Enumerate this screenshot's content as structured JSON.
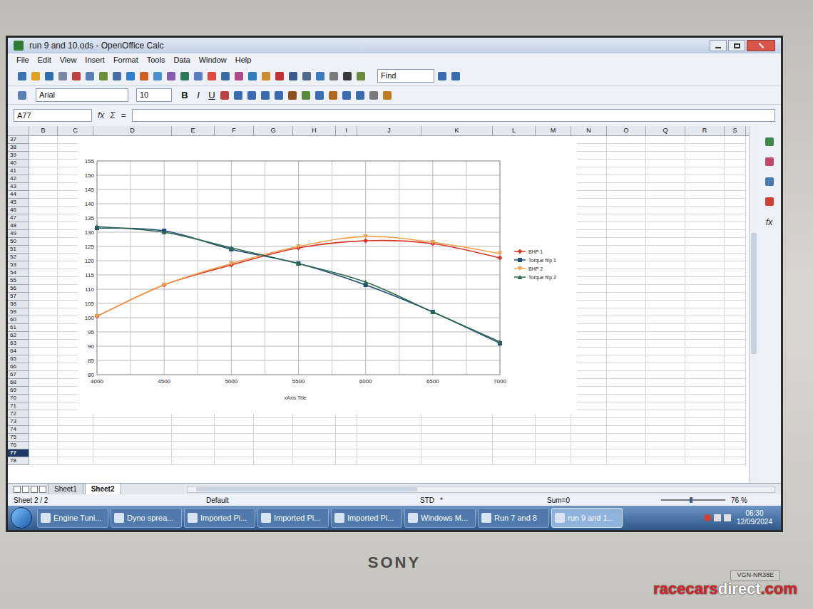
{
  "window": {
    "title": "run 9 and 10.ods - OpenOffice Calc"
  },
  "menu": [
    "File",
    "Edit",
    "View",
    "Insert",
    "Format",
    "Tools",
    "Data",
    "Window",
    "Help"
  ],
  "find": {
    "value": "Find"
  },
  "format_bar": {
    "font": "Arial",
    "size": "10",
    "buttons": [
      "B",
      "I",
      "U"
    ]
  },
  "formula_bar": {
    "cell": "A77",
    "symbols": [
      "fx",
      "Σ",
      "="
    ]
  },
  "columns": [
    "B",
    "C",
    "D",
    "E",
    "F",
    "G",
    "H",
    "I",
    "J",
    "K",
    "L",
    "M",
    "N",
    "O",
    "Q",
    "R",
    "S"
  ],
  "rows": [
    {
      "label": "37",
      "selected": false
    },
    {
      "label": "38",
      "selected": false
    },
    {
      "label": "39",
      "selected": false
    },
    {
      "label": "40",
      "selected": false
    },
    {
      "label": "41",
      "selected": false
    },
    {
      "label": "42",
      "selected": false
    },
    {
      "label": "43",
      "selected": false
    },
    {
      "label": "44",
      "selected": false
    },
    {
      "label": "45",
      "selected": false
    },
    {
      "label": "46",
      "selected": false
    },
    {
      "label": "47",
      "selected": false
    },
    {
      "label": "48",
      "selected": false
    },
    {
      "label": "49",
      "selected": false
    },
    {
      "label": "50",
      "selected": false
    },
    {
      "label": "51",
      "selected": false
    },
    {
      "label": "52",
      "selected": false
    },
    {
      "label": "53",
      "selected": false
    },
    {
      "label": "54",
      "selected": false
    },
    {
      "label": "55",
      "selected": false
    },
    {
      "label": "56",
      "selected": false
    },
    {
      "label": "57",
      "selected": false
    },
    {
      "label": "58",
      "selected": false
    },
    {
      "label": "59",
      "selected": false
    },
    {
      "label": "60",
      "selected": false
    },
    {
      "label": "61",
      "selected": false
    },
    {
      "label": "62",
      "selected": false
    },
    {
      "label": "63",
      "selected": false
    },
    {
      "label": "64",
      "selected": false
    },
    {
      "label": "65",
      "selected": false
    },
    {
      "label": "66",
      "selected": false
    },
    {
      "label": "67",
      "selected": false
    },
    {
      "label": "68",
      "selected": false
    },
    {
      "label": "69",
      "selected": false
    },
    {
      "label": "70",
      "selected": false
    },
    {
      "label": "71",
      "selected": false
    },
    {
      "label": "72",
      "selected": false
    },
    {
      "label": "73",
      "selected": false
    },
    {
      "label": "74",
      "selected": false
    },
    {
      "label": "75",
      "selected": false
    },
    {
      "label": "76",
      "selected": false
    },
    {
      "label": "77",
      "selected": true
    },
    {
      "label": "78",
      "selected": false
    }
  ],
  "chart": {
    "y_ticks": [
      "80",
      "85",
      "90",
      "95",
      "100",
      "105",
      "110",
      "115",
      "120",
      "125",
      "130",
      "135",
      "140",
      "145",
      "150",
      "155"
    ],
    "x_ticks": [
      "4000",
      "4500",
      "5000",
      "5500",
      "6000",
      "6500",
      "7000"
    ],
    "x_title": "xAxis Title",
    "series": [
      {
        "name": "BHP 1",
        "color": "#d9372a",
        "marker": "diamond",
        "values": [
          100.5,
          111.5,
          118.5,
          124.5,
          127,
          126,
          121
        ]
      },
      {
        "name": "Torque ft/p 1",
        "color": "#1f4a7a",
        "marker": "square",
        "values": [
          131.5,
          130.5,
          124,
          119,
          111.5,
          102,
          91
        ]
      },
      {
        "name": "BHP 2",
        "color": "#f0a24e",
        "marker": "triangle-down",
        "values": [
          100.5,
          111.5,
          119,
          125,
          128.5,
          126.5,
          122.5
        ]
      },
      {
        "name": "Torque ft/p 2",
        "color": "#2d6a4f",
        "marker": "triangle",
        "values": [
          132,
          130,
          124.5,
          119,
          112.5,
          102,
          91.5
        ]
      }
    ]
  },
  "sidebar": {
    "function_label": "fx"
  },
  "sheet_tabs": [
    {
      "label": "Sheet1",
      "selected": false
    },
    {
      "label": "Sheet2",
      "selected": true
    }
  ],
  "status_bar": {
    "sheet": "Sheet 2 / 2",
    "style": "Default",
    "mode": "STD",
    "modified": "*",
    "sum": "Sum=0",
    "zoom": "76 %"
  },
  "taskbar": {
    "items": [
      {
        "label": "Engine Tuni...",
        "selected": false
      },
      {
        "label": "Dyno sprea...",
        "selected": false
      },
      {
        "label": "Imported Pi...",
        "selected": false
      },
      {
        "label": "Imported Pi...",
        "selected": false
      },
      {
        "label": "Imported Pi...",
        "selected": false
      },
      {
        "label": "Windows M...",
        "selected": false
      },
      {
        "label": "Run 7 and 8",
        "selected": false
      },
      {
        "label": "run 9 and 1...",
        "selected": true
      }
    ],
    "time": "06:30",
    "date": "12/09/2024"
  },
  "laptop": {
    "brand": "SONY",
    "model": "VGN-NR38E"
  },
  "watermark": [
    {
      "text": "racecars",
      "color": "#d4262c"
    },
    {
      "text": "direct",
      "color": "#ffffff"
    },
    {
      "text": ".com",
      "color": "#d4262c"
    }
  ]
}
